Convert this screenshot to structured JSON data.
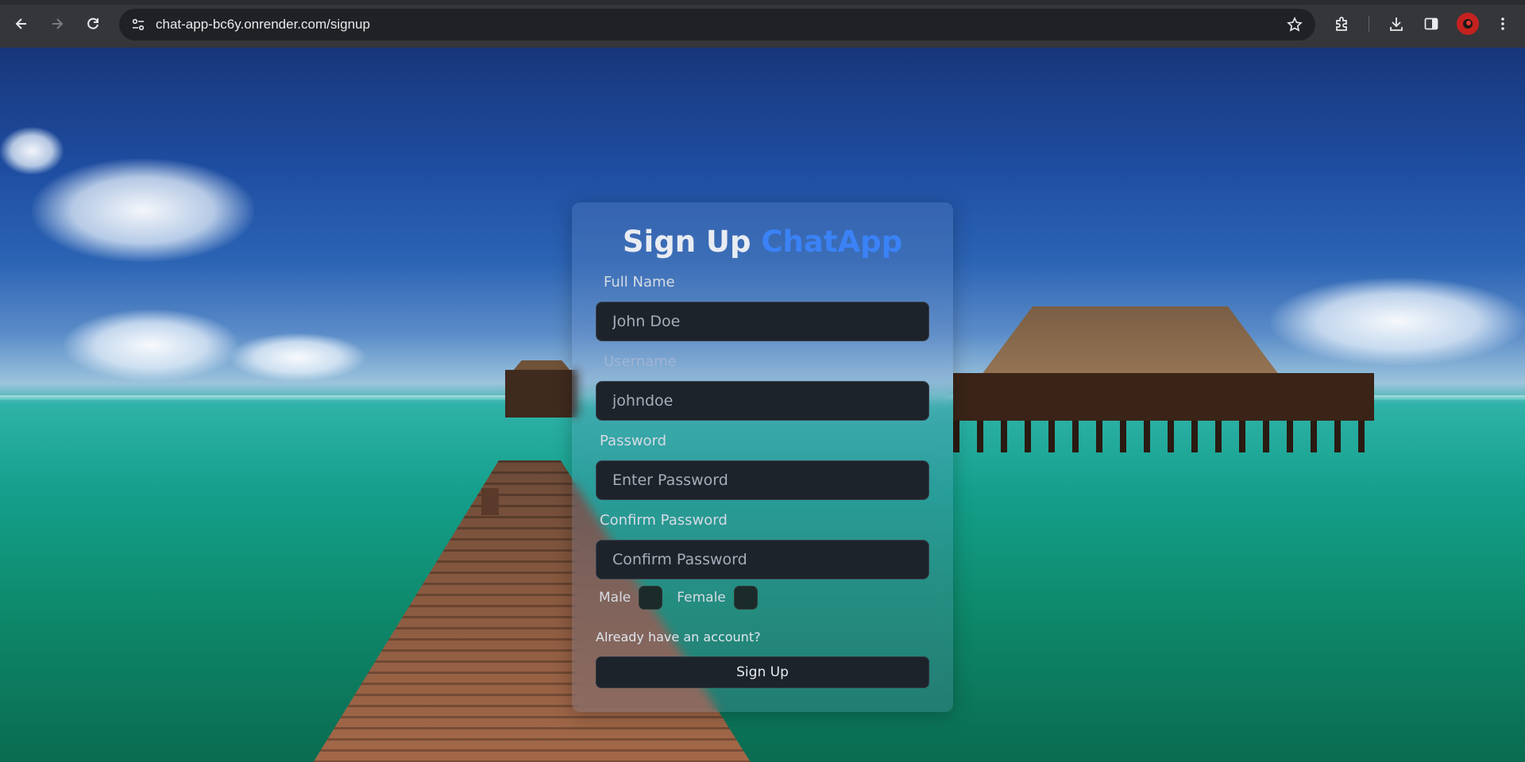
{
  "browser": {
    "url": "chat-app-bc6y.onrender.com/signup",
    "icons": {
      "back": "arrow-left-icon",
      "forward": "arrow-right-icon",
      "reload": "reload-icon",
      "site_info": "tune-icon",
      "bookmark": "star-icon",
      "extensions": "puzzle-icon",
      "downloads": "download-icon",
      "side_panel": "side-panel-icon",
      "profile": "avatar",
      "menu": "kebab-menu-icon"
    }
  },
  "signup": {
    "title_main": "Sign Up",
    "title_accent": "ChatApp",
    "accent_color": "#3b82f6",
    "fullname_label": "Full Name",
    "fullname_placeholder": "John Doe",
    "username_label": "Username",
    "username_placeholder": "johndoe",
    "password_label": "Password",
    "password_placeholder": "Enter Password",
    "confirm_label": "Confirm Password",
    "confirm_placeholder": "Confirm Password",
    "gender_male": "Male",
    "gender_female": "Female",
    "login_link": "Already have an account?",
    "submit_label": "Sign Up"
  }
}
